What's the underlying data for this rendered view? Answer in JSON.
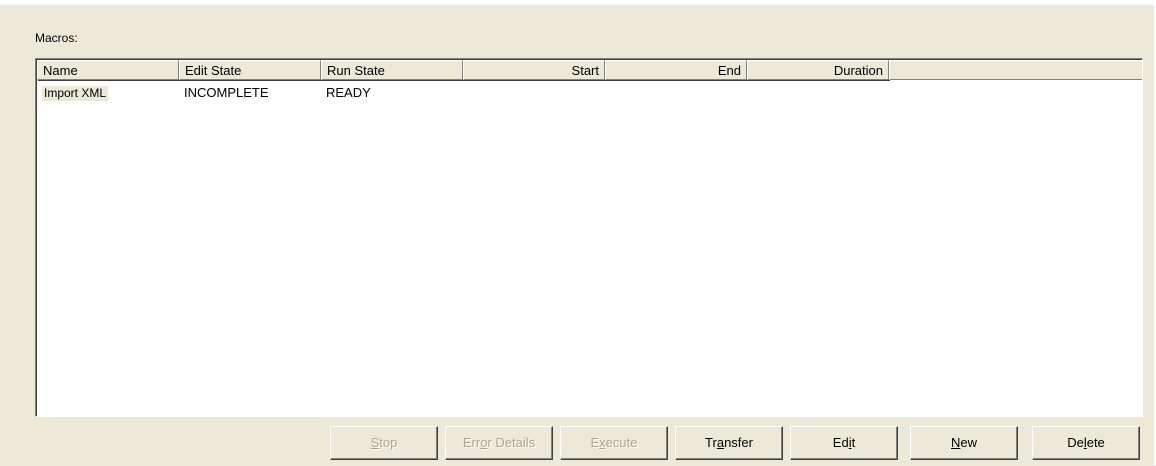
{
  "macros_label": "Macros:",
  "columns": [
    {
      "label": "Name",
      "align": "left"
    },
    {
      "label": "Edit State",
      "align": "left"
    },
    {
      "label": "Run State",
      "align": "left"
    },
    {
      "label": "Start",
      "align": "right"
    },
    {
      "label": "End",
      "align": "right"
    },
    {
      "label": "Duration",
      "align": "right"
    }
  ],
  "rows": [
    {
      "name": "Import XML",
      "edit_state": "INCOMPLETE",
      "run_state": "READY",
      "start": "",
      "end": "",
      "duration": ""
    }
  ],
  "buttons": [
    {
      "id": "stop",
      "label_pre": "",
      "label_ul": "S",
      "label_post": "top",
      "enabled": false
    },
    {
      "id": "error-details",
      "label_pre": "Err",
      "label_ul": "o",
      "label_post": "r Details",
      "enabled": false
    },
    {
      "id": "execute",
      "label_pre": "E",
      "label_ul": "x",
      "label_post": "ecute",
      "enabled": false
    },
    {
      "id": "transfer",
      "label_pre": "Tr",
      "label_ul": "a",
      "label_post": "nsfer",
      "enabled": true
    },
    {
      "id": "edit",
      "label_pre": "Ed",
      "label_ul": "i",
      "label_post": "t",
      "enabled": true
    },
    {
      "id": "new",
      "label_pre": "",
      "label_ul": "N",
      "label_post": "ew",
      "enabled": true
    },
    {
      "id": "delete",
      "label_pre": "De",
      "label_ul": "l",
      "label_post": "ete",
      "enabled": true
    }
  ],
  "colors": {
    "panel_bg": "#ece9d8",
    "disabled_text": "#a9a593"
  }
}
